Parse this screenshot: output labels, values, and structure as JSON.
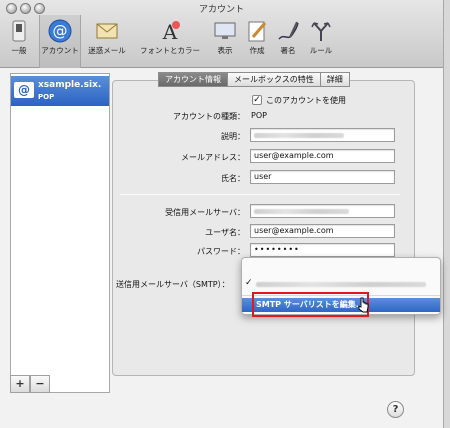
{
  "window": {
    "title": "アカウント"
  },
  "toolbar": {
    "items": [
      {
        "label": "一般"
      },
      {
        "label": "アカウント"
      },
      {
        "label": "迷惑メール"
      },
      {
        "label": "フォントとカラー"
      },
      {
        "label": "表示"
      },
      {
        "label": "作成"
      },
      {
        "label": "署名"
      },
      {
        "label": "ルール"
      }
    ]
  },
  "sidebar": {
    "account_name": "xsample.six.",
    "account_kind": "POP",
    "add_label": "+",
    "remove_label": "−"
  },
  "tabs": [
    {
      "label": "アカウント情報",
      "selected": true
    },
    {
      "label": "メールボックスの特性",
      "selected": false
    },
    {
      "label": "詳細",
      "selected": false
    }
  ],
  "form": {
    "enable_checkbox_label": "このアカウントを使用",
    "enable_checked": true,
    "check_glyph": "✓",
    "account_type_label": "アカウントの種類：",
    "account_type_value": "POP",
    "description_label": "説明：",
    "email_label": "メールアドレス：",
    "email_value": "user@example.com",
    "fullname_label": "氏名：",
    "fullname_value": "user",
    "incoming_server_label": "受信用メールサーバ：",
    "username_label": "ユーザ名：",
    "username_value": "user@example.com",
    "password_label": "パスワード：",
    "password_value": "••••••••",
    "smtp_label": "送信用メールサーバ（SMTP）："
  },
  "smtp_popup": {
    "check_glyph": "✓",
    "edit_item_label": "SMTP サーバリストを編集..."
  },
  "help": {
    "label": "?"
  },
  "colors": {
    "selection_blue": "#2f66c6",
    "highlight_red": "#e0191f"
  }
}
